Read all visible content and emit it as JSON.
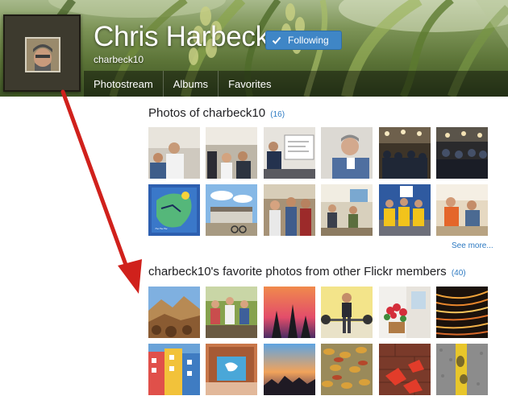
{
  "profile": {
    "name": "Chris Harbeck",
    "username": "charbeck10",
    "follow_button_label": "Following"
  },
  "nav": {
    "tabs": [
      {
        "label": "Photostream"
      },
      {
        "label": "Albums"
      },
      {
        "label": "Favorites"
      }
    ]
  },
  "photos_of": {
    "title": "Photos of charbeck10",
    "count": "(16)",
    "see_more": "See more..."
  },
  "favorites": {
    "title": "charbeck10's favorite photos from other Flickr members",
    "count": "(40)"
  },
  "colors": {
    "link": "#2d7ac2",
    "follow_button": "#3f86c6",
    "annotation_arrow": "#d0211c"
  },
  "icons": {
    "follow_check": "check-icon"
  }
}
